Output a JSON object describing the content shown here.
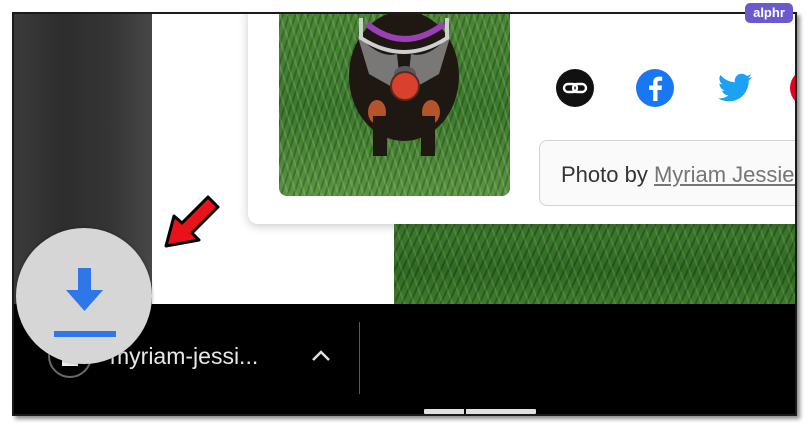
{
  "share_panel": {
    "buttons": [
      {
        "name": "link",
        "icon": "link-icon",
        "color": "#111111"
      },
      {
        "name": "facebook",
        "icon": "facebook-icon",
        "color": "#1877f2"
      },
      {
        "name": "twitter",
        "icon": "twitter-icon",
        "color": "#1da1f2"
      },
      {
        "name": "pinterest",
        "icon": "pinterest-icon",
        "color": "#e60023"
      }
    ],
    "credit": {
      "prefix": "Photo by ",
      "author": "Myriam Jessier"
    }
  },
  "download_shelf": {
    "file_name": "myriam-jessi...",
    "file_icon": "document-icon",
    "menu_icon": "chevron-up-icon"
  },
  "magnifier": {
    "icon": "download-icon",
    "accent": "#2f77e8"
  },
  "annotation": {
    "icon": "red-arrow-icon",
    "color": "#e8121a"
  },
  "brand": {
    "label": "alphr",
    "color": "#6a5acd"
  }
}
